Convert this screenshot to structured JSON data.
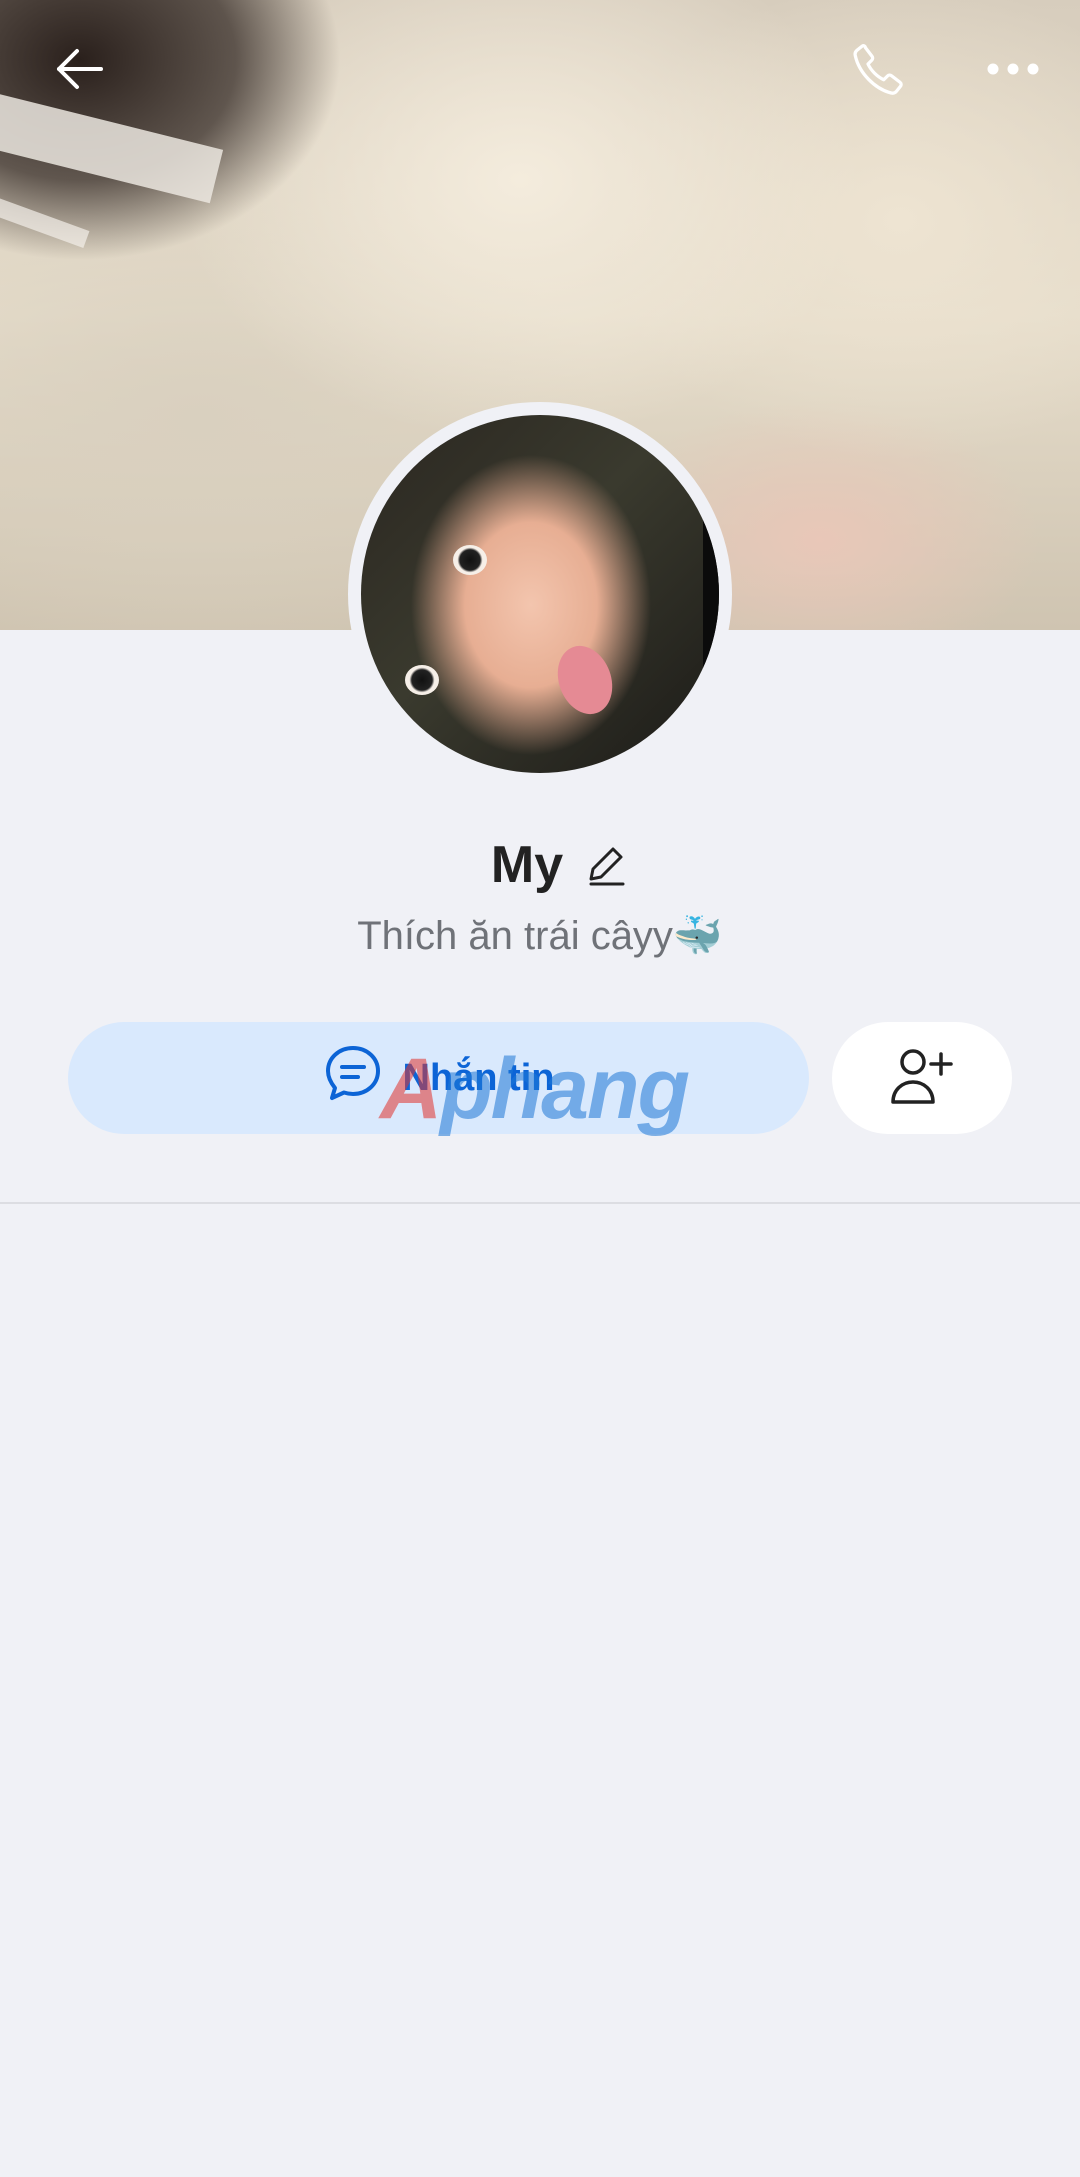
{
  "header": {
    "icons": {
      "back": "arrow-left",
      "call": "phone",
      "more": "more-horizontal"
    }
  },
  "profile": {
    "name": "My",
    "status": "Thích ăn trái câyy🐳"
  },
  "actions": {
    "message_label": "Nhắn tin",
    "message_icon": "chat-bubble",
    "add_friend_icon": "user-plus"
  },
  "watermark": {
    "first_letter": "A",
    "rest": "phang"
  },
  "colors": {
    "background": "#f0f1f6",
    "message_button_bg": "#d9e9fd",
    "accent": "#0c64d6",
    "name_text": "#222222",
    "status_text": "#6f7278"
  }
}
